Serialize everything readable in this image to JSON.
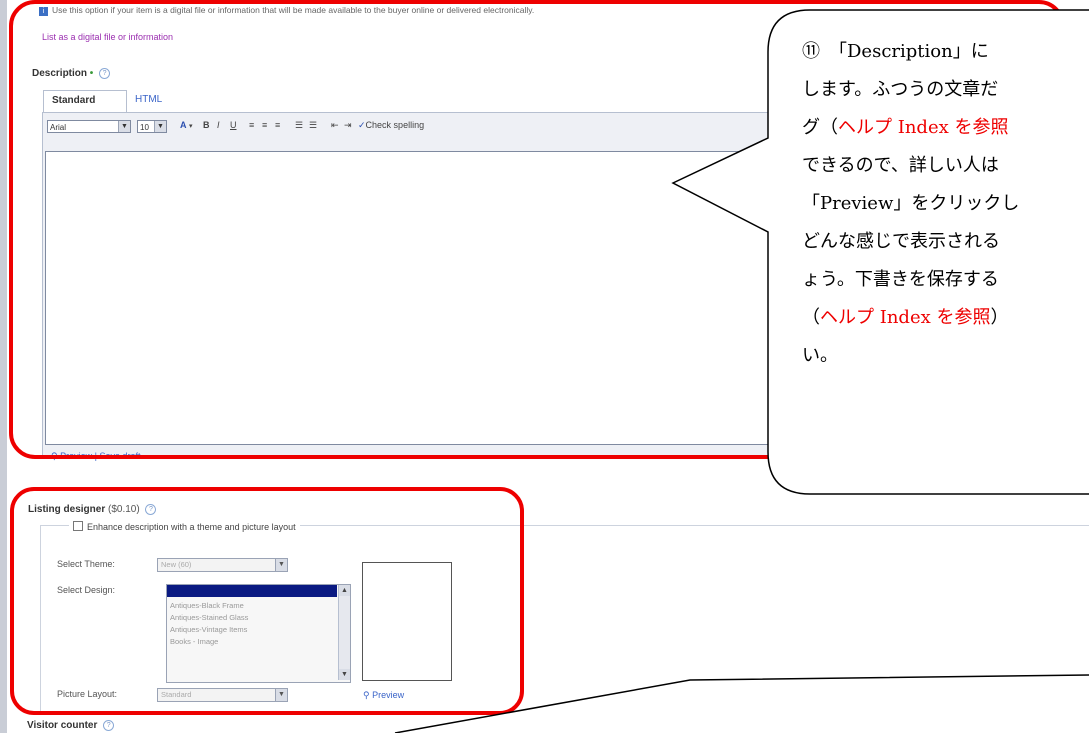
{
  "top_note": {
    "text": "Use this option if your item is a digital file or information that will be made available to the buyer online or delivered electronically.",
    "link": "List as a digital file or information"
  },
  "description": {
    "label": "Description",
    "required_mark": "•",
    "help": "?",
    "tabs": [
      "Standard",
      "HTML"
    ],
    "font_value": "Arial",
    "size_value": "10",
    "toolbar": [
      "A",
      "B",
      "I",
      "U",
      "Check spelling"
    ],
    "footer_preview": "Preview",
    "footer_sep": "|",
    "footer_save": "Save draft"
  },
  "listing_designer": {
    "label": "Listing designer",
    "price": "($0.10)",
    "help": "?",
    "enhance_label": "Enhance description with a theme and picture layout",
    "select_theme_label": "Select Theme:",
    "select_theme_value": "New (60)",
    "select_design_label": "Select Design:",
    "design_options": [
      "Antiques-Black Frame",
      "Antiques-Stained Glass",
      "Antiques-Vintage Items",
      "Books - Image"
    ],
    "picture_layout_label": "Picture Layout:",
    "picture_layout_value": "Standard",
    "preview_link": "Preview"
  },
  "visitor_counter": {
    "label": "Visitor counter",
    "help": "?"
  },
  "callout": {
    "lines": [
      [
        {
          "t": "⑪　「Description」に"
        }
      ],
      [
        {
          "t": "します。ふつうの文章だ"
        }
      ],
      [
        {
          "t": "グ（"
        },
        {
          "t": "ヘルプ Index を参照",
          "red": true
        }
      ],
      [
        {
          "t": "できるので、詳しい人は"
        }
      ],
      [
        {
          "t": "「Preview」をクリックし"
        }
      ],
      [
        {
          "t": "どんな感じで表示される"
        }
      ],
      [
        {
          "t": "ょう。下書きを保存する"
        }
      ],
      [
        {
          "t": "（"
        },
        {
          "t": "ヘルプ Index を参照",
          "red": true
        },
        {
          "t": "）"
        }
      ],
      [
        {
          "t": "い。"
        }
      ]
    ]
  },
  "colors": {
    "highlight_outline": "#e00000",
    "link": "#3a64c8",
    "required": "#3a9a3a"
  }
}
